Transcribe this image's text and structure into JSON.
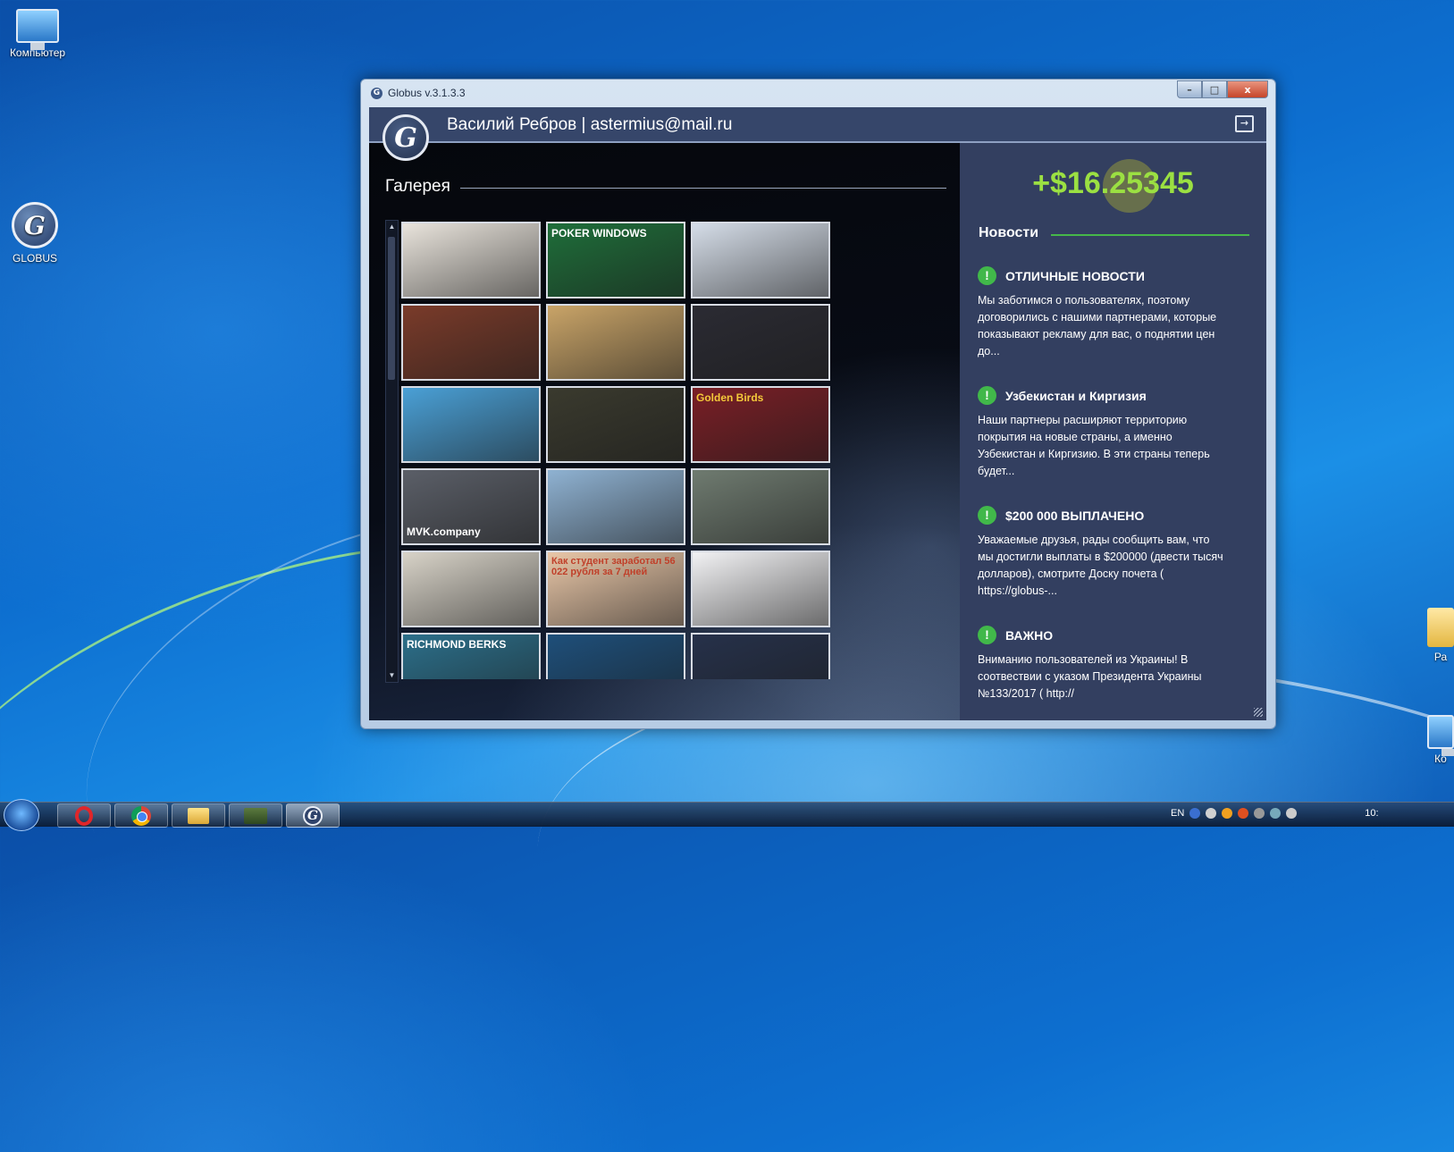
{
  "desktop": {
    "icons": [
      {
        "label": "Компьютер"
      },
      {
        "label": "GLOBUS"
      },
      {
        "label": "Ра"
      },
      {
        "label": "Ко"
      }
    ]
  },
  "window": {
    "title": "Globus v.3.1.3.3",
    "controls": {
      "minimize": "–",
      "maximize": "□",
      "close": "x"
    }
  },
  "app": {
    "logo_letter": "G",
    "user_label": "Василий Ребров | astermius@mail.ru",
    "gallery": {
      "title": "Галерея",
      "thumbnails": [
        {
          "caption": "",
          "bg": "#e9e4dc",
          "fg": "#333"
        },
        {
          "caption": "POKER   WINDOWS",
          "bg": "#1f6e3a",
          "fg": "#fff"
        },
        {
          "caption": "",
          "bg": "#d5dde8",
          "fg": "#333"
        },
        {
          "caption": "",
          "bg": "#7a3b2a",
          "fg": "#fff"
        },
        {
          "caption": "",
          "bg": "#c9a468",
          "fg": "#fff"
        },
        {
          "caption": "",
          "bg": "#2b2b33",
          "fg": "#fff"
        },
        {
          "caption": "",
          "bg": "#4aa0d6",
          "fg": "#fff"
        },
        {
          "caption": "",
          "bg": "#3a3a2e",
          "fg": "#f2d23c"
        },
        {
          "caption": "Golden Birds",
          "bg": "#7a1f26",
          "fg": "#f4c93a"
        },
        {
          "caption": "MVK.company",
          "bg": "#5b5f68",
          "fg": "#fff"
        },
        {
          "caption": "",
          "bg": "#8fb2d2",
          "fg": "#fff"
        },
        {
          "caption": "",
          "bg": "#6f7b70",
          "fg": "#fff"
        },
        {
          "caption": "",
          "bg": "#d8d3c8",
          "fg": "#333"
        },
        {
          "caption": "Как студент заработал 56 022 рубля за 7 дней",
          "bg": "#e9c7a8",
          "fg": "#c0402a"
        },
        {
          "caption": "",
          "bg": "#f2f2f4",
          "fg": "#333"
        },
        {
          "caption": "RICHMOND BERKS",
          "bg": "#2c6f8a",
          "fg": "#fff"
        },
        {
          "caption": "",
          "bg": "#1e4f7a",
          "fg": "#fff"
        },
        {
          "caption": "",
          "bg": "#26314a",
          "fg": "#fff"
        }
      ]
    },
    "balance": "+$16.25345",
    "news": {
      "title": "Новости",
      "items": [
        {
          "headline": "ОТЛИЧНЫЕ НОВОСТИ",
          "body": "Мы заботимся о пользователях, поэтому договорились с нашими партнерами, которые показывают рекламу для вас, о поднятии цен до..."
        },
        {
          "headline": "Узбекистан и Киргизия",
          "body": "Наши партнеры расширяют территорию покрытия на новые страны, а именно Узбекистан и Киргизию. В эти страны теперь будет..."
        },
        {
          "headline": "$200 000 ВЫПЛАЧЕНО",
          "body": "Уважаемые друзья, рады сообщить вам, что мы достигли выплаты в $200000 (двести тысяч долларов), смотрите Доску почета ( https://globus-..."
        },
        {
          "headline": "ВАЖНО",
          "body": "Вниманию пользователей из Украины! В соотвествии с указом Президента Украины №133/2017 ( http://"
        }
      ]
    }
  },
  "taskbar": {
    "tray_lang": "EN",
    "clock": "10:"
  },
  "colors": {
    "balance": "#9be042",
    "news_accent": "#41b84a",
    "app_header": "#36466a"
  }
}
